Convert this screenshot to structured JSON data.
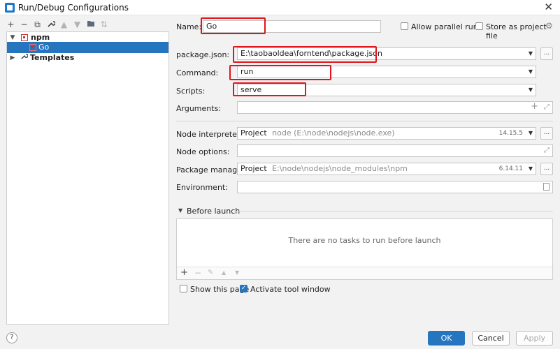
{
  "window": {
    "title": "Run/Debug Configurations",
    "close_glyph": "✕"
  },
  "left_toolbar": [
    {
      "name": "add-icon",
      "glyph": "+"
    },
    {
      "name": "remove-icon",
      "glyph": "−"
    },
    {
      "name": "copy-icon",
      "glyph": "⧉"
    },
    {
      "name": "wrench-icon",
      "glyph": "🔧"
    },
    {
      "name": "move-up-icon",
      "glyph": "▲"
    },
    {
      "name": "move-down-icon",
      "glyph": "▼"
    },
    {
      "name": "folder-icon",
      "glyph": "▣"
    },
    {
      "name": "sort-icon",
      "glyph": "⇅"
    }
  ],
  "tree": {
    "npm_label": "npm",
    "go_label": "Go",
    "templates_label": "Templates"
  },
  "form": {
    "name_label": "Name:",
    "name_value": "Go",
    "allow_parallel_label": "Allow parallel run",
    "store_project_label": "Store as project file",
    "package_json_label": "package.json:",
    "package_json_value": "E:\\taobaoldea\\forntend\\package.json",
    "command_label": "Command:",
    "command_value": "run",
    "scripts_label": "Scripts:",
    "scripts_value": "serve",
    "arguments_label": "Arguments:",
    "node_interpreter_label": "Node interpreter:",
    "node_interpreter_prefix": "Project",
    "node_interpreter_path": "node (E:\\node\\nodejs\\node.exe)",
    "node_interpreter_version": "14.15.5",
    "node_options_label": "Node options:",
    "package_manager_label": "Package manager:",
    "package_manager_prefix": "Project",
    "package_manager_path": "E:\\node\\nodejs\\node_modules\\npm",
    "package_manager_version": "6.14.11",
    "environment_label": "Environment:",
    "dots": "..."
  },
  "before_launch": {
    "title": "Before launch",
    "empty_text": "There are no tasks to run before launch"
  },
  "options": {
    "show_page_label": "Show this page",
    "activate_tool_label": "Activate tool window",
    "show_page_checked": false,
    "activate_tool_checked": true
  },
  "buttons": {
    "ok": "OK",
    "cancel": "Cancel",
    "apply": "Apply",
    "help": "?"
  },
  "colors": {
    "accent": "#2675bf",
    "highlight_box": "#e0161b"
  }
}
